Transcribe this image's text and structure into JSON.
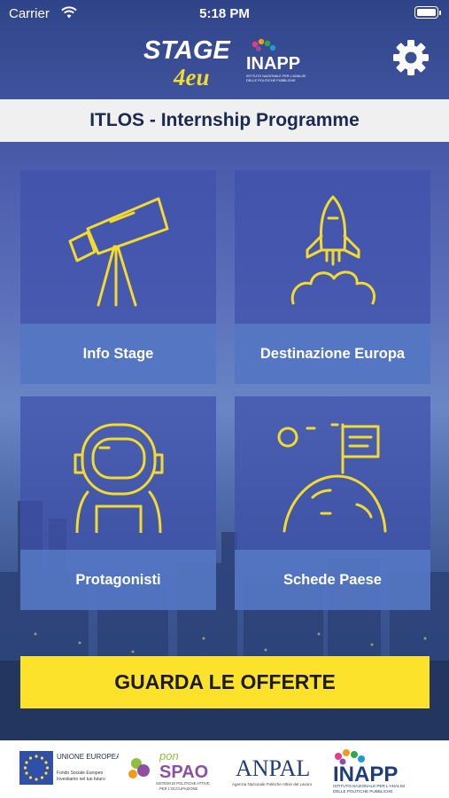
{
  "status_bar": {
    "carrier": "Carrier",
    "time": "5:18 PM"
  },
  "header": {
    "stage_logo": {
      "line1": "STAGE",
      "line2": "4eu"
    },
    "inapp_logo": {
      "text": "INAPP",
      "sub1": "ISTITUTO NAZIONALE PER L'ANALISI",
      "sub2": "DELLE POLITICHE PUBBLICHE"
    },
    "settings_icon": "gear-icon"
  },
  "title": "ITLOS - Internship Programme",
  "tiles": [
    {
      "label": "Info Stage",
      "icon": "telescope-icon"
    },
    {
      "label": "Destinazione Europa",
      "icon": "rocket-icon"
    },
    {
      "label": "Protagonisti",
      "icon": "astronaut-icon"
    },
    {
      "label": "Schede Paese",
      "icon": "planet-flag-icon"
    }
  ],
  "cta_label": "GUARDA LE OFFERTE",
  "footer": {
    "eu": {
      "title": "UNIONE EUROPEA",
      "line1": "Fondo Sociale Europeo",
      "line2": "Investiamo nel tuo futuro"
    },
    "ponspao": {
      "pon": "pon",
      "spao": "SPAO",
      "sub1": "SISTEMI DI POLITICHE ATTIVE",
      "sub2": "PER L'OCCUPAZIONE"
    },
    "anpal": {
      "text": "ANPAL",
      "sub": "Agenzia Nazionale Politiche Attive del Lavoro"
    },
    "inapp": {
      "text": "INAPP",
      "sub1": "ISTITUTO NAZIONALE PER L'ANALISI",
      "sub2": "DELLE POLITICHE PUBBLICHE"
    }
  },
  "colors": {
    "accent_yellow": "#fce22a",
    "icon_yellow": "#f2da2e",
    "tile_blue": "#3f50aa",
    "title_text": "#1b2a52"
  }
}
